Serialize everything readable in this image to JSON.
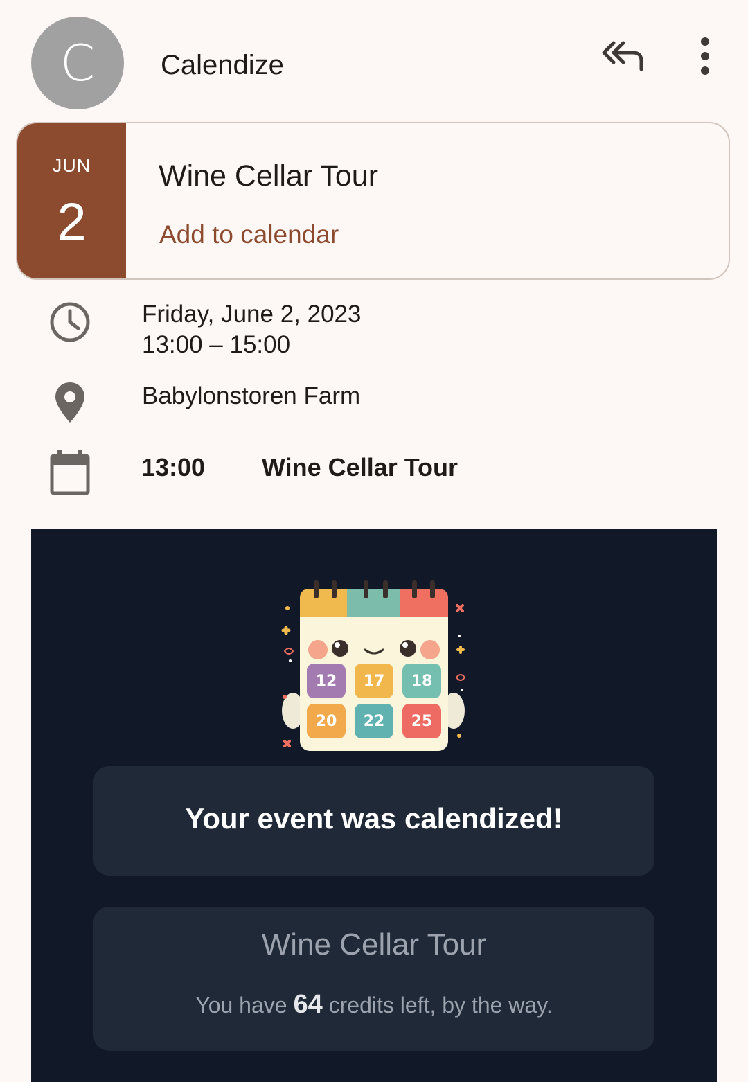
{
  "header": {
    "avatar_letter": "C",
    "sender_name": "Calendize",
    "reply_all_icon": "reply-all-icon",
    "more_icon": "more-vert-icon"
  },
  "event_card": {
    "month": "JUN",
    "day": "2",
    "title": "Wine Cellar Tour",
    "add_to_calendar": "Add to calendar",
    "accent_color": "#8c4a2f"
  },
  "details": {
    "date": "Friday, June 2, 2023",
    "time_range": "13:00 – 15:00",
    "location": "Babylonstoren Farm",
    "agenda": {
      "time": "13:00",
      "title": "Wine Cellar Tour"
    },
    "icons": [
      "clock-icon",
      "location-pin-icon",
      "calendar-icon"
    ]
  },
  "email_body": {
    "background_color": "#111827",
    "panel_color": "#1f2937",
    "mascot_numbers": [
      "12",
      "17",
      "18",
      "20",
      "22",
      "25"
    ],
    "success_message": "Your event was calendized!",
    "event_title": "Wine Cellar Tour",
    "credits_prefix": "You have ",
    "credits_count": "64",
    "credits_suffix": " credits left, by the way."
  }
}
